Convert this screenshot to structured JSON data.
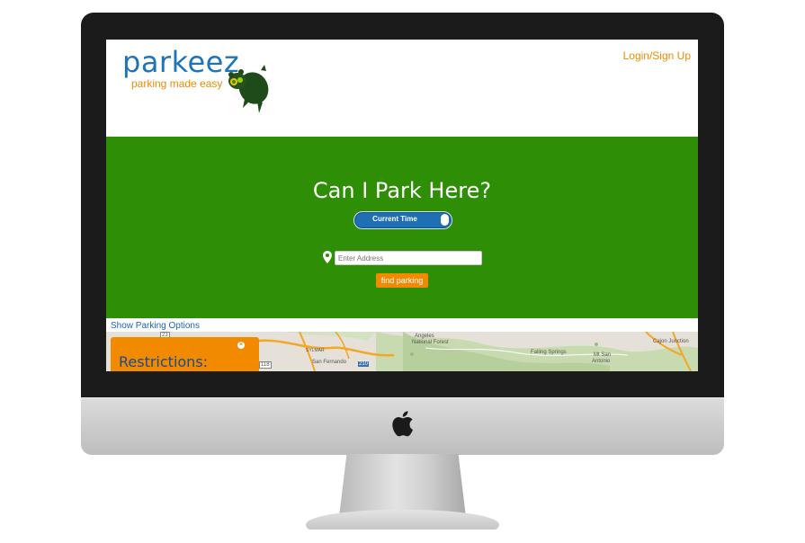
{
  "brand": {
    "name": "parkeez",
    "tagline": "parking made easy",
    "color": "#1d75b8",
    "accent": "#f28a00"
  },
  "header": {
    "login_label": "Login/Sign Up"
  },
  "hero": {
    "title": "Can I Park Here?",
    "background": "#2e8e05",
    "toggle_label": "Current Time",
    "address_placeholder": "Enter Address",
    "find_button": "find parking"
  },
  "options": {
    "show_label": "Show Parking Options"
  },
  "map": {
    "labels": {
      "angeles": "Angeles",
      "national_forest": "National Forest",
      "falling_springs": "Falling Springs",
      "mt_san": "Mt San",
      "antonio": "Antonio",
      "cajon_junction": "Cajon Junction",
      "san_fernando": "San Fernando",
      "sylmar": "SYLMAR",
      "shield_210": "210",
      "shield_118": "118",
      "shield_23": "23"
    }
  },
  "restrictions": {
    "title": "Restrictions:",
    "close_symbol": "×"
  }
}
